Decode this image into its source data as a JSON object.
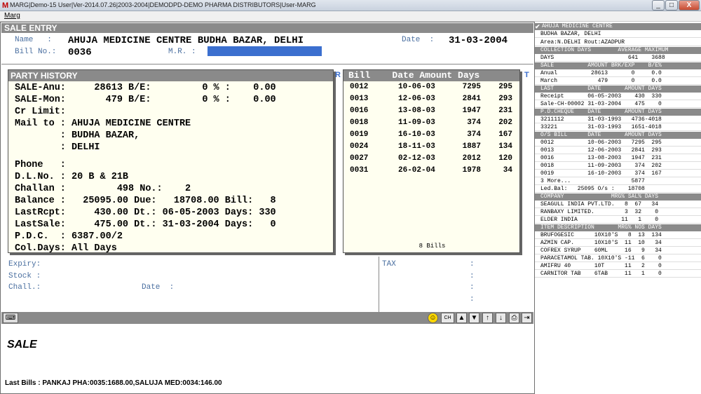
{
  "titlebar": {
    "title": "MARG|Demo-15 User|Ver-2014.07.26|2003-2004|DEMODPD-DEMO  PHARMA  DISTRIBUTORS|User-MARG",
    "logo": "M",
    "min": "_",
    "max": "□",
    "close": "X"
  },
  "menu": {
    "marg": "Marg"
  },
  "entry": {
    "title": "SALE ENTRY",
    "name_label": "Name   :",
    "name_value": "AHUJA MEDICINE CENTRE BUDHA BAZAR, DELHI",
    "date_label": "Date  :",
    "date_value": "31-03-2004",
    "bill_label": "Bill No.:",
    "bill_value": "0036",
    "mr_label": "M.R. :"
  },
  "party": {
    "title": "PARTY HISTORY",
    "lines": [
      "SALE-Anu:     28613 B/E:         0 % :    0.00",
      "SALE-Mon:       479 B/E:         0 % :    0.00",
      "Cr Limit:",
      "Mail to : AHUJA MEDICINE CENTRE",
      "        : BUDHA BAZAR,",
      "        : DELHI",
      "",
      "Phone   :",
      "D.L.No. : 20 B & 21B",
      "Challan :         498 No.:    2",
      "Balance :   25095.00 Due:   18708.00 Bill:   8",
      "LastRcpt:     430.00 Dt.: 06-05-2003 Days: 330",
      "LastSale:     475.00 Dt.: 31-03-2004 Days:   0",
      "P.D.C.  : 6387.00/2",
      "Col.Days: All Days"
    ]
  },
  "bills": {
    "header": "Bill    Date Amount Days",
    "rows": [
      {
        "bill": "0012",
        "date": "10-06-03",
        "amount": "7295",
        "days": "295"
      },
      {
        "bill": "0013",
        "date": "12-06-03",
        "amount": "2841",
        "days": "293"
      },
      {
        "bill": "0016",
        "date": "13-08-03",
        "amount": "1947",
        "days": "231"
      },
      {
        "bill": "0018",
        "date": "11-09-03",
        "amount": "374",
        "days": "202"
      },
      {
        "bill": "0019",
        "date": "16-10-03",
        "amount": "374",
        "days": "167"
      },
      {
        "bill": "0024",
        "date": "18-11-03",
        "amount": "1887",
        "days": "134"
      },
      {
        "bill": "0027",
        "date": "02-12-03",
        "amount": "2012",
        "days": "120"
      },
      {
        "bill": "0031",
        "date": "26-02-04",
        "amount": "1978",
        "days": "34"
      }
    ],
    "footer": "8 Bills",
    "edge_r": "R",
    "edge_t": "T"
  },
  "lower": {
    "expiry": "Expiry:",
    "stock": "Stock :",
    "chall": "Chall.:",
    "date": "Date  :",
    "tax": "TAX",
    "colon": ":"
  },
  "status": {
    "mode": "SALE",
    "last_bills": "Last Bills : PANKAJ PHA:0035:1688.00,SALUJA MED:0034:146.00"
  },
  "right": {
    "name": "AHUJA MEDICINE CENTRE",
    "addr": "BUDHA BAZAR, DELHI",
    "area": "Area:N.DELHI Rout:AZADPUR",
    "col_hdr": "COLLECTION DAYS        AVERAGE MAXIMUM",
    "col_row": "DAYS                      641    3688",
    "sale_hdr": "SALE          AMOUNT BRK/EXP    B/E%",
    "sale_rows": [
      "Anual          28613       0     0.0",
      "March            479       0     0.0"
    ],
    "last_hdr": "LAST          DATE       AMOUNT DAYS",
    "last_rows": [
      "Receipt       06-05-2003    430  330",
      "Sale-CH-00002 31-03-2004    475    0"
    ],
    "pdc_hdr": "P.D.CHEQUE    DATE       AMOUNT DAYS",
    "pdc_rows": [
      "3211112       31-03-1993   4736-4018",
      "33221         31-03-1993   1651-4018"
    ],
    "os_hdr": "O/S BILL      DATE       AMOUNT DAYS",
    "os_rows": [
      "0012          10-06-2003   7295  295",
      "0013          12-06-2003   2841  293",
      "0016          13-08-2003   1947  231",
      "0018          11-09-2003    374  202",
      "0019          16-10-2003    374  167",
      "3 More...                  5877",
      "Led.Bal:   25095 O/s :    18708"
    ],
    "comp_hdr": "COMPANY              MRG% SAL% DAYS",
    "comp_rows": [
      "SEAGULL INDIA PVT.LTD.   8  67   34",
      "RANBAXY LIMITED.         3  32    0",
      "ELDER INDIA             11   1    0"
    ],
    "item_hdr": "ITEM DESCRIPTION       MRG% NOS DAYS",
    "item_rows": [
      "BRUFOGESIC      10X10'S   8  13  134",
      "AZMIN CAP.      10X10'S  11  10   34",
      "COFREX SYRUP    60ML     16   9   34",
      "PARACETAMOL TAB. 10X10'S -11  6    0",
      "AMIFRU 40       10T      11   2    0",
      "CARNITOR TAB    6TAB     11   1    0"
    ]
  },
  "colors": {
    "accent": "#3b6fcf",
    "header_gray": "#8a8a8a",
    "label_blue": "#4a6fa0",
    "popup_bg": "#fffff0"
  }
}
